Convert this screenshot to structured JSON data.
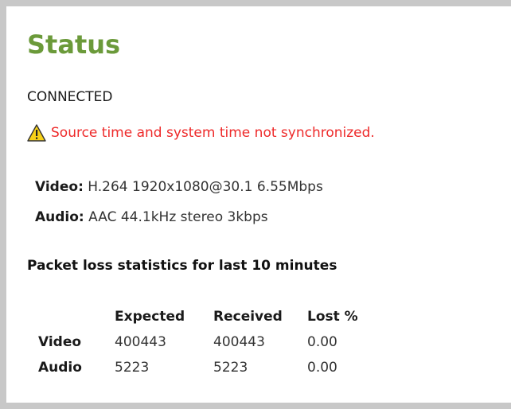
{
  "status": {
    "title": "Status",
    "connection": "CONNECTED",
    "warning": {
      "icon": "warning-icon",
      "text": "Source time and system time not synchronized.",
      "color": "#ee2a2a"
    },
    "video": {
      "label": "Video:",
      "value": "H.264 1920x1080@30.1 6.55Mbps"
    },
    "audio": {
      "label": "Audio:",
      "value": "AAC 44.1kHz stereo 3kbps"
    }
  },
  "packet_loss": {
    "title": "Packet loss statistics for last 10 minutes",
    "columns": [
      "",
      "Expected",
      "Received",
      "Lost %"
    ],
    "rows": [
      {
        "label": "Video",
        "expected": "400443",
        "received": "400443",
        "lost": "0.00"
      },
      {
        "label": "Audio",
        "expected": "5223",
        "received": "5223",
        "lost": "0.00"
      }
    ]
  },
  "colors": {
    "title": "#6b9a3a",
    "border": "#c8c8c8"
  }
}
